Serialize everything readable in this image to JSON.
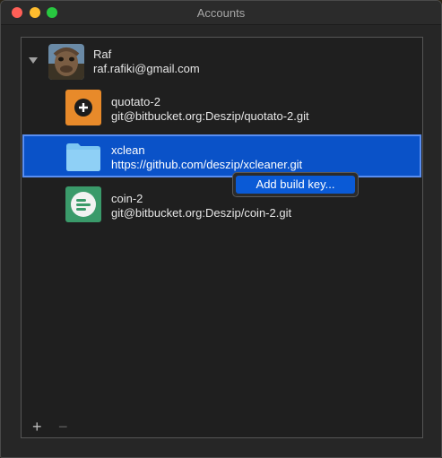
{
  "window": {
    "title": "Accounts"
  },
  "account": {
    "name": "Raf",
    "email": "raf.rafiki@gmail.com",
    "avatar_icon": "user-avatar-icon"
  },
  "repositories": [
    {
      "name": "quotato-2",
      "url": "git@bitbucket.org:Deszip/quotato-2.git",
      "icon": "quotato-app-icon",
      "selected": false
    },
    {
      "name": "xclean",
      "url": "https://github.com/deszip/xcleaner.git",
      "icon": "folder-icon",
      "selected": true
    },
    {
      "name": "coin-2",
      "url": "git@bitbucket.org:Deszip/coin-2.git",
      "icon": "coin-app-icon",
      "selected": false
    }
  ],
  "context_menu": {
    "items": [
      "Add build key..."
    ]
  },
  "toolbar": {
    "add_label": "+",
    "remove_label": "−"
  },
  "colors": {
    "selection": "#0a52c8",
    "menu_highlight": "#0a5ad6"
  }
}
